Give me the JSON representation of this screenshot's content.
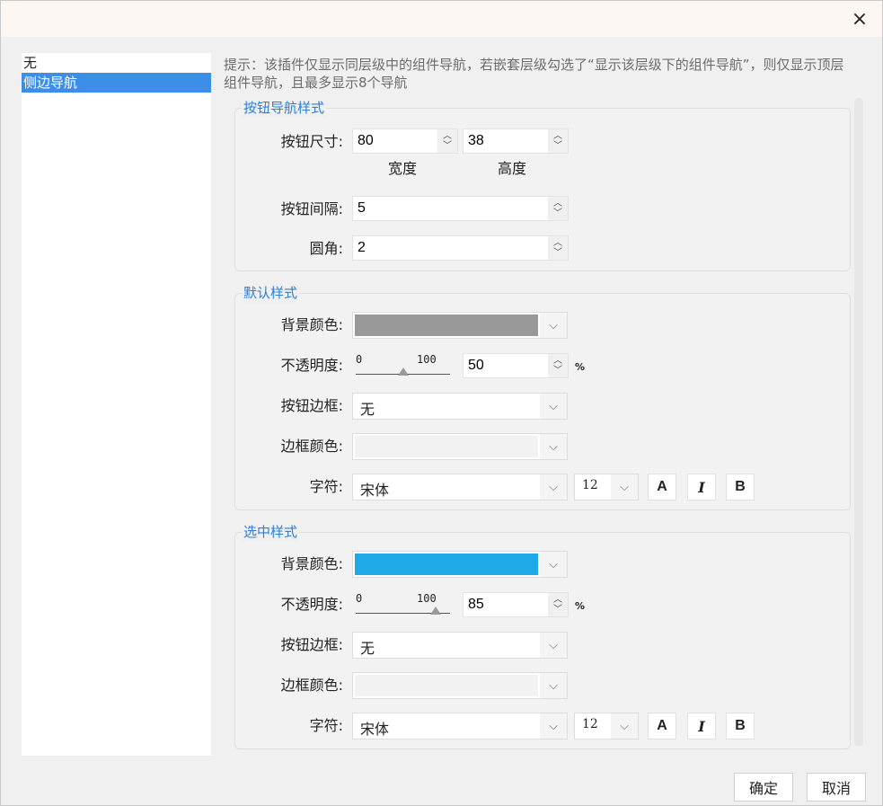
{
  "left_list": {
    "items": [
      "无",
      "侧边导航"
    ],
    "selected_index": 1
  },
  "hint": "提示：该插件仅显示同层级中的组件导航，若嵌套层级勾选了“显示该层级下的组件导航”，则仅显示顶层组件导航，且最多显示8个导航",
  "button_style": {
    "title": "按钮导航样式",
    "size_label": "按钮尺寸:",
    "width_value": "80",
    "height_value": "38",
    "width_caption": "宽度",
    "height_caption": "高度",
    "spacing_label": "按钮间隔:",
    "spacing_value": "5",
    "radius_label": "圆角:",
    "radius_value": "2"
  },
  "default_style": {
    "title": "默认样式",
    "bg_label": "背景颜色:",
    "bg_color": "#999999",
    "opacity_label": "不透明度:",
    "slider_min": "0",
    "slider_max": "100",
    "opacity_value": "50",
    "opacity_fraction": 0.5,
    "percent": "%",
    "border_label": "按钮边框:",
    "border_value": "无",
    "border_color_label": "边框颜色:",
    "font_label": "字符:",
    "font_value": "宋体",
    "font_size": "12",
    "btn_color": "A",
    "btn_italic": "I",
    "btn_bold": "B"
  },
  "selected_style": {
    "title": "选中样式",
    "bg_label": "背景颜色:",
    "bg_color": "#1fa9e6",
    "opacity_label": "不透明度:",
    "slider_min": "0",
    "slider_max": "100",
    "opacity_value": "85",
    "opacity_fraction": 0.85,
    "percent": "%",
    "border_label": "按钮边框:",
    "border_value": "无",
    "border_color_label": "边框颜色:",
    "font_label": "字符:",
    "font_value": "宋体",
    "font_size": "12",
    "btn_color": "A",
    "btn_italic": "I",
    "btn_bold": "B"
  },
  "footer": {
    "ok_label": "确定",
    "cancel_label": "取消"
  },
  "icons": {
    "close": "×",
    "spin_up": "︿",
    "spin_down": "﹀",
    "dropdown": "⌵"
  }
}
